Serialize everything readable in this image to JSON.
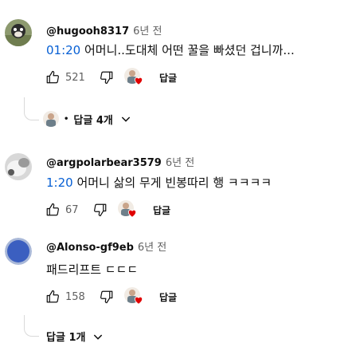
{
  "comments": [
    {
      "author": "@hugooh8317",
      "time": "6년 전",
      "timestamp": "01:20",
      "text": " 어머니..도대체 어떤 꿀을 빠셨던 겁니까...",
      "likes": "521",
      "reply_label": "답글",
      "replies_toggle": "답글 4개"
    },
    {
      "author": "@argpolarbear3579",
      "time": "6년 전",
      "timestamp": "1:20",
      "text": " 어머니 삶의 무게 빈봉따리 행 ㅋㅋㅋㅋ",
      "likes": "67",
      "reply_label": "답글"
    },
    {
      "author": "@Alonso-gf9eb",
      "time": "6년 전",
      "timestamp": "",
      "text": "패드리프트 ㄷㄷㄷ",
      "likes": "158",
      "reply_label": "답글",
      "replies_toggle": "답글 1개"
    }
  ],
  "colors": {
    "link": "#065fd4",
    "meta": "#606060",
    "heart": "#e00000",
    "avatar3": "#3b5fc0"
  }
}
